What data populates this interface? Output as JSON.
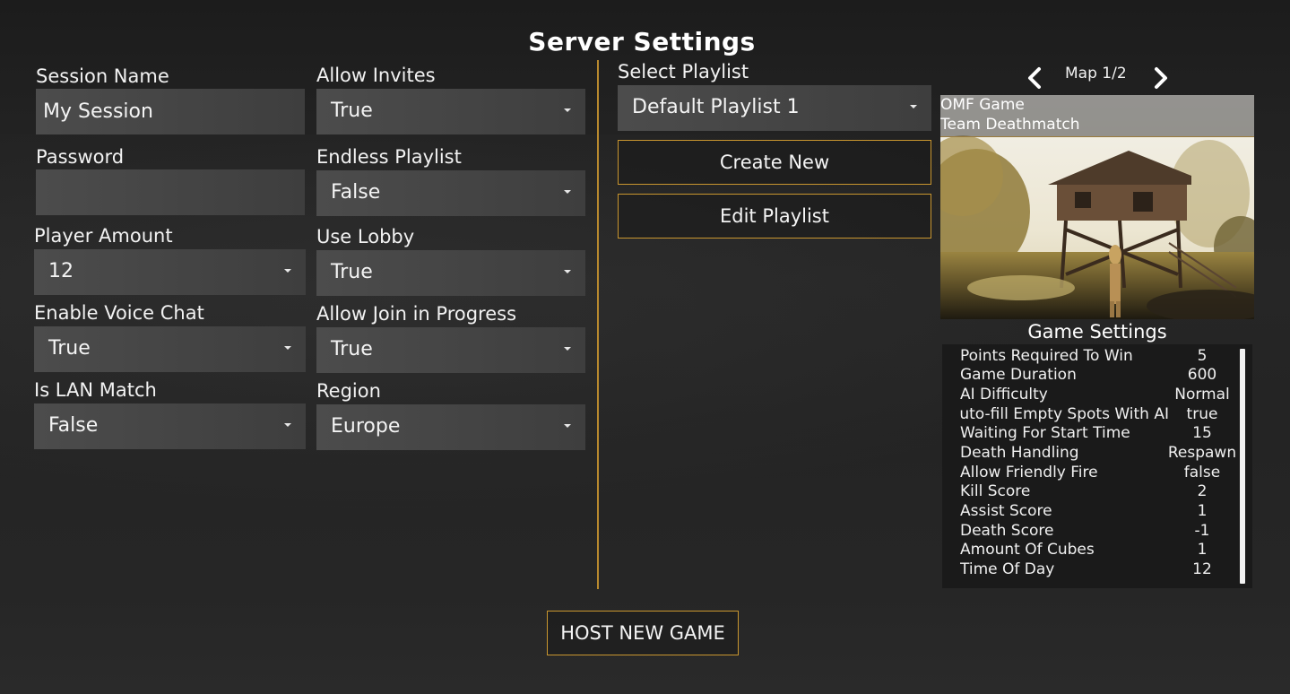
{
  "title": "Server Settings",
  "session": {
    "name_label": "Session Name",
    "name_value": "My Session",
    "password_label": "Password",
    "password_value": "",
    "player_amount_label": "Player Amount",
    "player_amount_value": "12",
    "voice_chat_label": "Enable Voice Chat",
    "voice_chat_value": "True",
    "lan_label": "Is LAN Match",
    "lan_value": "False"
  },
  "options": {
    "allow_invites_label": "Allow Invites",
    "allow_invites_value": "True",
    "endless_label": "Endless Playlist",
    "endless_value": "False",
    "use_lobby_label": "Use Lobby",
    "use_lobby_value": "True",
    "join_progress_label": "Allow Join in Progress",
    "join_progress_value": "True",
    "region_label": "Region",
    "region_value": "Europe"
  },
  "playlist": {
    "select_label": "Select Playlist",
    "selected": "Default Playlist 1",
    "create_new": "Create New",
    "edit": "Edit Playlist"
  },
  "map": {
    "counter": "Map 1/2",
    "prev_icon": "chevron-left-icon",
    "next_icon": "chevron-right-icon",
    "game_name": "OMF Game",
    "mode": "Team Deathmatch"
  },
  "game_settings": {
    "title": "Game Settings",
    "rows": [
      {
        "key": "Points Required To Win",
        "value": "5"
      },
      {
        "key": "Game Duration",
        "value": "600"
      },
      {
        "key": "AI Difficulty",
        "value": "Normal"
      },
      {
        "key": "Auto-fill Empty Spots With AI",
        "value": "true"
      },
      {
        "key": "Waiting For Start Time",
        "value": "15"
      },
      {
        "key": "Death Handling",
        "value": "Respawn"
      },
      {
        "key": "Allow Friendly Fire",
        "value": "false"
      },
      {
        "key": "Kill Score",
        "value": "2"
      },
      {
        "key": "Assist Score",
        "value": "1"
      },
      {
        "key": "Death Score",
        "value": "-1"
      },
      {
        "key": "Amount Of Cubes",
        "value": "1"
      },
      {
        "key": "Time Of Day",
        "value": "12"
      }
    ]
  },
  "host_button": "HOST NEW GAME",
  "colors": {
    "accent": "#c9962f",
    "field": "#464646",
    "panel": "#1a1a1a"
  }
}
